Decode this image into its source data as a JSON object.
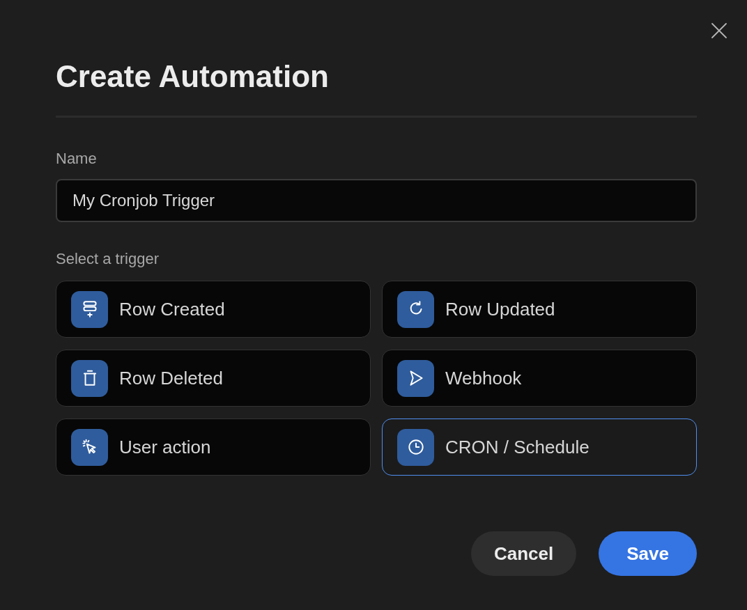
{
  "dialog": {
    "title": "Create Automation"
  },
  "name_field": {
    "label": "Name",
    "value": "My Cronjob Trigger"
  },
  "trigger_section": {
    "label": "Select a trigger"
  },
  "triggers": [
    {
      "kind": "row_created",
      "label": "Row Created",
      "selected": false
    },
    {
      "kind": "row_updated",
      "label": "Row Updated",
      "selected": false
    },
    {
      "kind": "row_deleted",
      "label": "Row Deleted",
      "selected": false
    },
    {
      "kind": "webhook",
      "label": "Webhook",
      "selected": false
    },
    {
      "kind": "user_action",
      "label": "User action",
      "selected": false
    },
    {
      "kind": "schedule",
      "label": "CRON / Schedule",
      "selected": true
    }
  ],
  "buttons": [
    {
      "kind": "secondary",
      "label": "Cancel"
    },
    {
      "kind": "primary",
      "label": "Save"
    }
  ]
}
